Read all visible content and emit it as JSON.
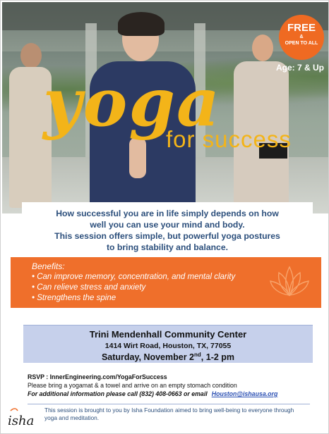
{
  "badge": {
    "free": "FREE",
    "amp": "&",
    "open": "OPEN TO ALL"
  },
  "age": "Age: 7 & Up",
  "title": {
    "yoga": "yoga",
    "subtitle": "for success"
  },
  "intro": [
    "How successful you are in life simply depends on how",
    "well you can use your mind and body.",
    "This session offers simple, but powerful yoga postures",
    "to bring stability and balance."
  ],
  "benefits": {
    "title": "Benefits:",
    "items": [
      "• Can improve memory, concentration, and mental clarity",
      "• Can relieve stress and anxiety",
      "• Strengthens the spine"
    ]
  },
  "venue": {
    "name": "Trini Mendenhall Community Center",
    "address": "1414 Wirt Road, Houston, TX, 77055",
    "date_prefix": "Saturday, November 2",
    "date_sup": "nd",
    "date_suffix": ", 1-2 pm"
  },
  "rsvp": {
    "line1": "RSVP : InnerEngineering.com/YogaForSuccess",
    "line2": "Please bring a yogamat & a towel and arrive on an empty stomach condition",
    "line3": "For additional information please call (832) 408-0663 or email",
    "email": "Houston@ishausa.org"
  },
  "footer": "This session is brought to you by Isha Foundation aimed to bring well-being to everyone through yoga and meditation.",
  "logo_text": "isha",
  "colors": {
    "accent_orange": "#ef6f2b",
    "title_yellow": "#f3b419",
    "text_blue": "#2c4f7c",
    "venue_bg": "#c6d0eb"
  }
}
